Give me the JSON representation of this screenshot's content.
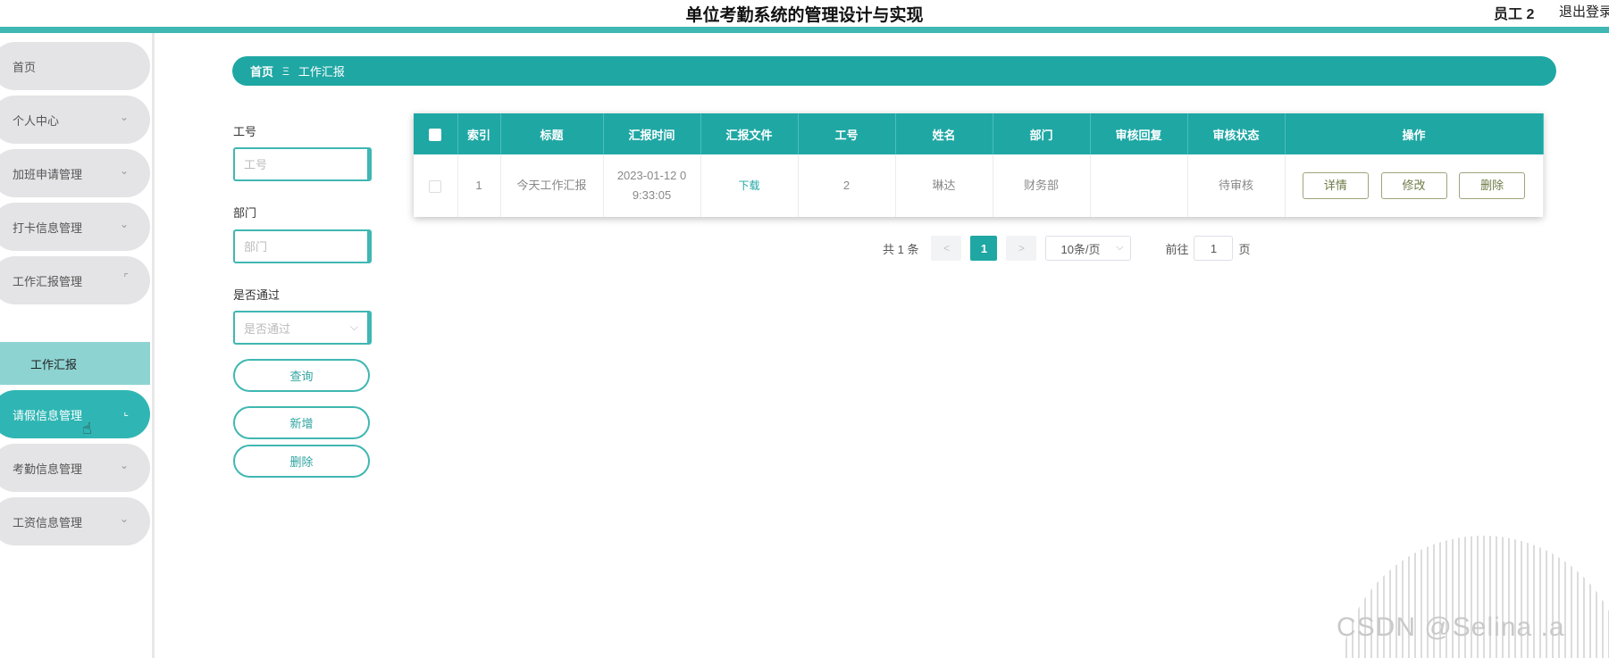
{
  "header": {
    "title": "单位考勤系统的管理设计与实现",
    "user": "员工 2",
    "logout": "退出登录"
  },
  "sidebar": {
    "items": [
      {
        "label": "首页",
        "chevron": ""
      },
      {
        "label": "个人中心",
        "chevron": "⌄"
      },
      {
        "label": "加班申请管理",
        "chevron": "⌄"
      },
      {
        "label": "打卡信息管理",
        "chevron": "⌄"
      },
      {
        "label": "工作汇报管理",
        "chevron": "⌜"
      },
      {
        "label": "请假信息管理",
        "chevron": "⌞"
      },
      {
        "label": "考勤信息管理",
        "chevron": "⌄"
      },
      {
        "label": "工资信息管理",
        "chevron": "⌄"
      }
    ],
    "submenu": "工作汇报"
  },
  "breadcrumb": {
    "home": "首页",
    "separator": "Ξ",
    "current": "工作汇报"
  },
  "search": {
    "emp_no_label": "工号",
    "emp_no_placeholder": "工号",
    "dept_label": "部门",
    "dept_placeholder": "部门",
    "passed_label": "是否通过",
    "passed_placeholder": "是否通过",
    "query_btn": "查询",
    "add_btn": "新增",
    "delete_btn": "删除"
  },
  "table": {
    "headers": [
      "索引",
      "标题",
      "汇报时间",
      "汇报文件",
      "工号",
      "姓名",
      "部门",
      "审核回复",
      "审核状态",
      "操作"
    ],
    "rows": [
      {
        "index": "1",
        "title": "今天工作汇报",
        "time_line1": "2023-01-12 0",
        "time_line2": "9:33:05",
        "file": "下载",
        "emp_no": "2",
        "name": "琳达",
        "dept": "财务部",
        "reply": "",
        "status": "待审核",
        "actions": [
          "详情",
          "修改",
          "删除"
        ]
      }
    ]
  },
  "pagination": {
    "total": "共 1 条",
    "prev": "<",
    "page": "1",
    "next": ">",
    "page_size": "10条/页",
    "goto_label": "前往",
    "goto_value": "1",
    "page_suffix": "页"
  },
  "watermark": "CSDN @Selina .a",
  "colors": {
    "accent": "#1fa7a4",
    "sidebar_active": "#2fb6b4",
    "submenu": "#8dd3d1"
  }
}
